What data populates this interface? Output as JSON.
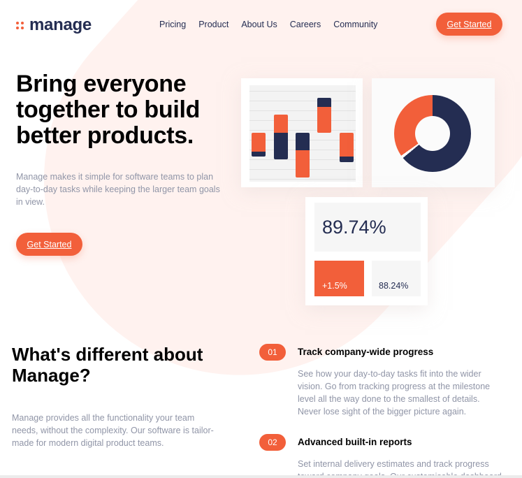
{
  "header": {
    "logo_text": "manage",
    "logo_icon": "four-dot-grid-icon",
    "nav": [
      "Pricing",
      "Product",
      "About Us",
      "Careers",
      "Community"
    ],
    "cta_label": "Get Started"
  },
  "hero": {
    "title": "Bring everyone together to build better products.",
    "description": "Manage makes it simple for software teams to plan day-to-day tasks while keeping the larger team goals in view.",
    "cta_label": "Get Started"
  },
  "illustration": {
    "donut": {
      "navy_fraction": 0.64,
      "orange_fraction": 0.35
    },
    "stats": {
      "main": "89.74%",
      "change": "+1.5%",
      "secondary": "88.24%"
    }
  },
  "section": {
    "title": "What's different about Manage?",
    "description": "Manage provides all the functionality your team needs, without the complexity. Our software is tailor-made for modern digital product teams.",
    "features": [
      {
        "number": "01",
        "title": "Track company-wide progress",
        "description": "See how your day-to-day tasks fit into the wider vision. Go from tracking progress at the milestone level all the way done to the smallest of details. Never lose sight of the bigger picture again."
      },
      {
        "number": "02",
        "title": "Advanced built-in reports",
        "description": "Set internal delivery estimates and track progress toward company goals. Our customisable dashboard"
      }
    ]
  },
  "colors": {
    "accent": "#f25f3a",
    "navy": "#242d52",
    "muted_text": "#9095a7",
    "blob": "#fff2ef"
  }
}
